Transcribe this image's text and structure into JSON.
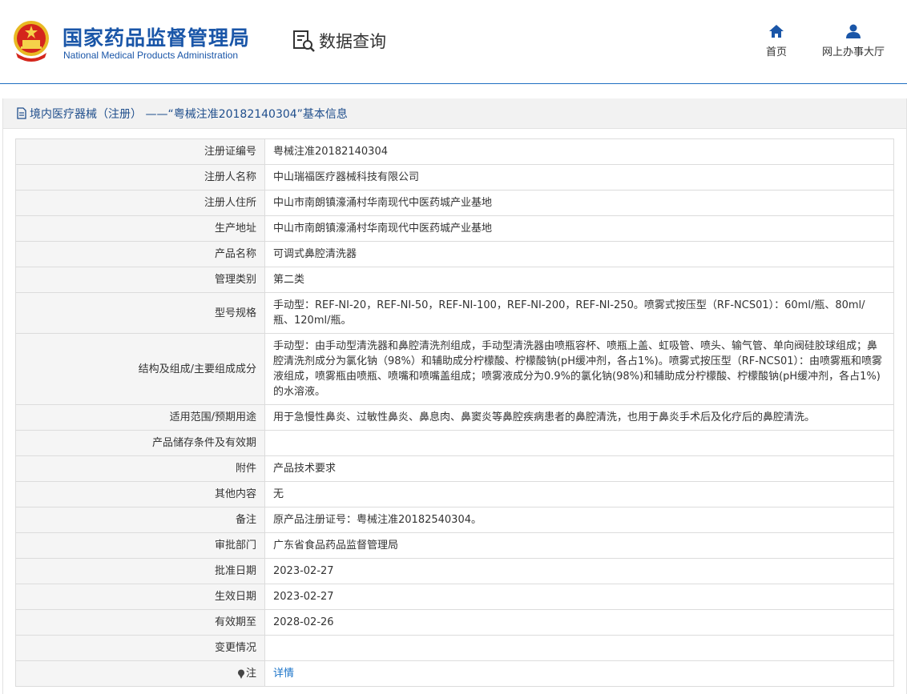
{
  "header": {
    "agency_cn": "国家药品监督管理局",
    "agency_en": "National Medical Products Administration",
    "query_title": "数据查询",
    "nav": {
      "home_label": "首页",
      "hall_label": "网上办事大厅"
    }
  },
  "colors": {
    "brand_blue": "#1a56a8",
    "link_blue": "#1a73c8",
    "label_bg": "#f5f5f5"
  },
  "panel": {
    "title": "境内医疗器械（注册） ——“粤械注准20182140304”基本信息"
  },
  "rows": [
    {
      "label": "注册证编号",
      "value": "粤械注准20182140304"
    },
    {
      "label": "注册人名称",
      "value": "中山瑞福医疗器械科技有限公司"
    },
    {
      "label": "注册人住所",
      "value": "中山市南朗镇濠涌村华南现代中医药城产业基地"
    },
    {
      "label": "生产地址",
      "value": "中山市南朗镇濠涌村华南现代中医药城产业基地"
    },
    {
      "label": "产品名称",
      "value": "可调式鼻腔清洗器"
    },
    {
      "label": "管理类别",
      "value": "第二类"
    },
    {
      "label": "型号规格",
      "value": "手动型：REF-NI-20，REF-NI-50，REF-NI-100，REF-NI-200，REF-NI-250。喷雾式按压型（RF-NCS01）：60ml/瓶、80ml/瓶、120ml/瓶。"
    },
    {
      "label": "结构及组成/主要组成成分",
      "value": "手动型：由手动型清洗器和鼻腔清洗剂组成，手动型清洗器由喷瓶容杯、喷瓶上盖、虹吸管、喷头、输气管、单向阀硅胶球组成；鼻腔清洗剂成分为氯化钠（98%）和辅助成分柠檬酸、柠檬酸钠(pH缓冲剂，各占1%)。喷雾式按压型（RF-NCS01）：由喷雾瓶和喷雾液组成，喷雾瓶由喷瓶、喷嘴和喷嘴盖组成；喷雾液成分为0.9%的氯化钠(98%)和辅助成分柠檬酸、柠檬酸钠(pH缓冲剂，各占1%)的水溶液。"
    },
    {
      "label": "适用范围/预期用途",
      "value": "用于急慢性鼻炎、过敏性鼻炎、鼻息肉、鼻窦炎等鼻腔疾病患者的鼻腔清洗，也用于鼻炎手术后及化疗后的鼻腔清洗。"
    },
    {
      "label": "产品储存条件及有效期",
      "value": ""
    },
    {
      "label": "附件",
      "value": "产品技术要求"
    },
    {
      "label": "其他内容",
      "value": "无"
    },
    {
      "label": "备注",
      "value": "原产品注册证号：粤械注准20182540304。"
    },
    {
      "label": "审批部门",
      "value": "广东省食品药品监督管理局"
    },
    {
      "label": "批准日期",
      "value": "2023-02-27"
    },
    {
      "label": "生效日期",
      "value": "2023-02-27"
    },
    {
      "label": "有效期至",
      "value": "2028-02-26"
    },
    {
      "label": "变更情况",
      "value": ""
    }
  ],
  "note_row": {
    "label": "注",
    "link": "详情"
  }
}
